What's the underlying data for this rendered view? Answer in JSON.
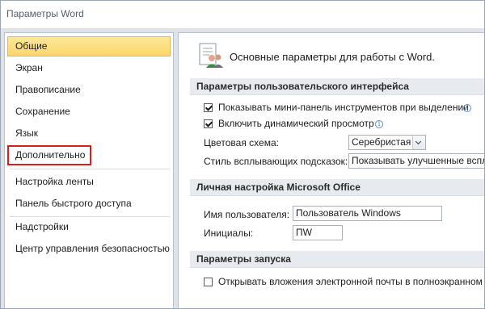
{
  "window": {
    "title": "Параметры Word"
  },
  "sidebar": {
    "items": [
      {
        "label": "Общие"
      },
      {
        "label": "Экран"
      },
      {
        "label": "Правописание"
      },
      {
        "label": "Сохранение"
      },
      {
        "label": "Язык"
      },
      {
        "label": "Дополнительно"
      },
      {
        "label": "Настройка ленты"
      },
      {
        "label": "Панель быстрого доступа"
      },
      {
        "label": "Надстройки"
      },
      {
        "label": "Центр управления безопасностью"
      }
    ],
    "selected": "Общие",
    "highlighted": "Дополнительно"
  },
  "content": {
    "header": "Основные параметры для работы с Word.",
    "header_icon": "options-people-icon",
    "ui_section": {
      "title": "Параметры пользовательского интерфейса",
      "mini_toolbar": {
        "label": "Показывать мини-панель инструментов при выделении",
        "checked": true
      },
      "live_preview": {
        "label": "Включить динамический просмотр",
        "checked": true
      },
      "color_scheme": {
        "label": "Цветовая схема:",
        "value": "Серебристая"
      },
      "screentip": {
        "label": "Стиль всплывающих подсказок:",
        "value": "Показывать улучшенные всплы"
      }
    },
    "personal_section": {
      "title": "Личная настройка Microsoft Office",
      "username": {
        "label": "Имя пользователя:",
        "value": "Пользователь Windows"
      },
      "initials": {
        "label": "Инициалы:",
        "value": "ПW"
      }
    },
    "startup_section": {
      "title": "Параметры запуска",
      "open_attachments": {
        "label": "Открывать вложения электронной почты в полноэкранном р",
        "checked": false
      }
    }
  },
  "colors": {
    "selected_bg": "#fbd66a",
    "highlight_outline": "#d3201f",
    "section_bg": "#e7eaee"
  }
}
